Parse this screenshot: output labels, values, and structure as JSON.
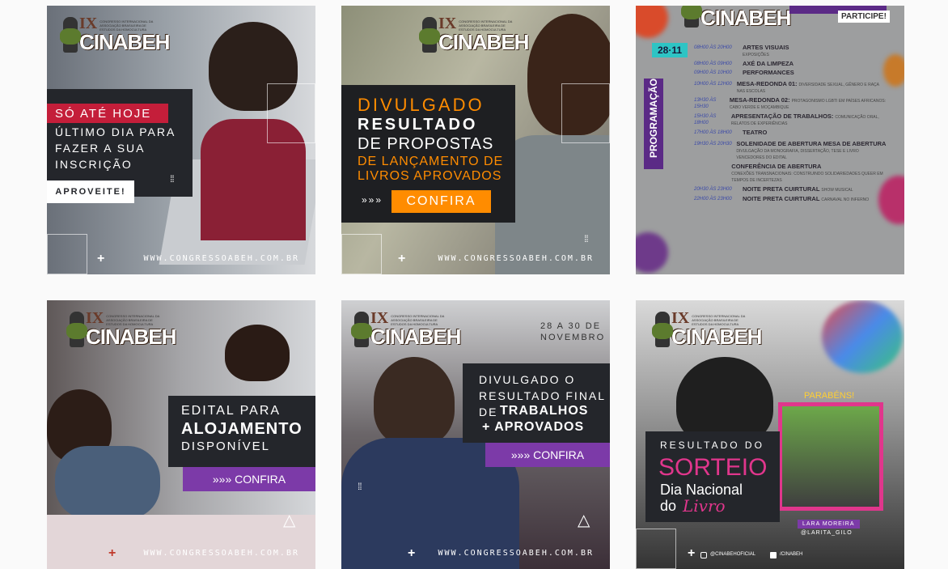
{
  "posts": [
    {
      "logo": {
        "ix": "IX",
        "name": "CINABEH",
        "sub": "CONGRESSO INTERNACIONAL DA ASSOCIAÇÃO BRASILEIRA DE ESTUDOS DA HOMOCULTURA"
      },
      "highlight": "SÓ ATÉ HOJE",
      "lines": [
        "ÚLTIMO DIA PARA",
        "FAZER A SUA",
        "INSCRIÇÃO"
      ],
      "button": "APROVEITE!",
      "url": "WWW.CONGRESSOABEH.COM.BR"
    },
    {
      "logo": {
        "ix": "IX",
        "name": "CINABEH",
        "sub": "CONGRESSO INTERNACIONAL DA ASSOCIAÇÃO BRASILEIRA DE ESTUDOS DA HOMOCULTURA"
      },
      "line1": "DIVULGADO",
      "line2": "RESULTADO",
      "line3": "DE PROPOSTAS",
      "line4": "DE LANÇAMENTO DE",
      "line5": "LIVROS APROVADOS",
      "arrows": "»»»",
      "button": "CONFIRA",
      "url": "WWW.CONGRESSOABEH.COM.BR"
    },
    {
      "logo": {
        "ix": "IX",
        "name": "CINABEH"
      },
      "badge": "PARTICIPE!",
      "date": "28·11",
      "side": "PROGRAMAÇÃO",
      "schedule": [
        {
          "time": "08H00 ÀS 20H00",
          "event": "ARTES VISUAIS",
          "detail": "EXPOSIÇÕES"
        },
        {
          "time": "08H00 ÀS 09H00",
          "event": "AXÉ DA LIMPEZA",
          "detail": ""
        },
        {
          "time": "09H00 ÀS 10H00",
          "event": "PERFORMANCES",
          "detail": ""
        },
        {
          "time": "10H00 ÀS 12H00",
          "event": "MESA-REDONDA 01:",
          "detail": "DIVERSIDADE SEXUAL, GÊNERO E RAÇA NAS ESCOLAS"
        },
        {
          "time": "13H30 ÀS 15H30",
          "event": "MESA-REDONDA 02:",
          "detail": "PROTAGONISMO LGBTI EM PAÍSES AFRICANOS: CABO VERDE E MOÇAMBIQUE"
        },
        {
          "time": "15H30 ÀS 18H00",
          "event": "APRESENTAÇÃO DE TRABALHOS:",
          "detail": "COMUNICAÇÃO ORAL, RELATOS DE EXPERIÊNCIAS"
        },
        {
          "time": "17H00 ÀS 18H00",
          "event": "TEATRO",
          "detail": ""
        },
        {
          "time": "19H30 ÀS 20H30",
          "event": "SOLENIDADE DE ABERTURA MESA DE ABERTURA",
          "detail": "DIVULGAÇÃO DA MONOGRAFIA, DISSERTAÇÃO, TESE E LIVRO VENCEDORES DO EDITAL"
        },
        {
          "time": "",
          "event": "CONFERÊNCIA DE ABERTURA",
          "detail": "CONEXÕES TRANSNACIONAIS: CONSTRUINDO SOLIDARIEDADES QUEER EM TEMPOS DE INCERTEZAS"
        },
        {
          "time": "20H30 ÀS 23H00",
          "event": "NOITE PRETA CUIRTURAL",
          "detail": "SHOW MUSICAL"
        },
        {
          "time": "22H00 ÀS 23H00",
          "event": "NOITE PRETA CUIRTURAL",
          "detail": "CARNAVAL NO INFERNO"
        }
      ]
    },
    {
      "logo": {
        "ix": "IX",
        "name": "CINABEH",
        "sub": "CONGRESSO INTERNACIONAL DA ASSOCIAÇÃO BRASILEIRA DE ESTUDOS DA HOMOCULTURA"
      },
      "line1": "EDITAL PARA",
      "line2": "ALOJAMENTO",
      "line3": "DISPONÍVEL",
      "button": "»»» CONFIRA",
      "url": "WWW.CONGRESSOABEH.COM.BR"
    },
    {
      "logo": {
        "ix": "IX",
        "name": "CINABEH",
        "sub": "CONGRESSO INTERNACIONAL DA ASSOCIAÇÃO BRASILEIRA DE ESTUDOS DA HOMOCULTURA"
      },
      "dates": [
        "28 A 30 DE",
        "NOVEMBRO"
      ],
      "line1": "DIVULGADO O",
      "line2": "RESULTADO FINAL",
      "line3a": "DE",
      "line3b": "TRABALHOS",
      "line4": "+ APROVADOS",
      "button": "»»» CONFIRA",
      "url": "WWW.CONGRESSOABEH.COM.BR"
    },
    {
      "logo": {
        "ix": "IX",
        "name": "CINABEH",
        "sub": "CONGRESSO INTERNACIONAL DA ASSOCIAÇÃO BRASILEIRA DE ESTUDOS DA HOMOCULTURA"
      },
      "congrats": "PARABÉNS!",
      "line1": "RESULTADO DO",
      "line2": "SORTEIO",
      "line3": "Dia Nacional",
      "line4a": "do",
      "line4b": "Livro",
      "winner": "LARA MOREIRA",
      "handle": "@LARITA_GILO",
      "social1": "@CINABEHOFICIAL",
      "social2": "/CINABEH"
    }
  ]
}
